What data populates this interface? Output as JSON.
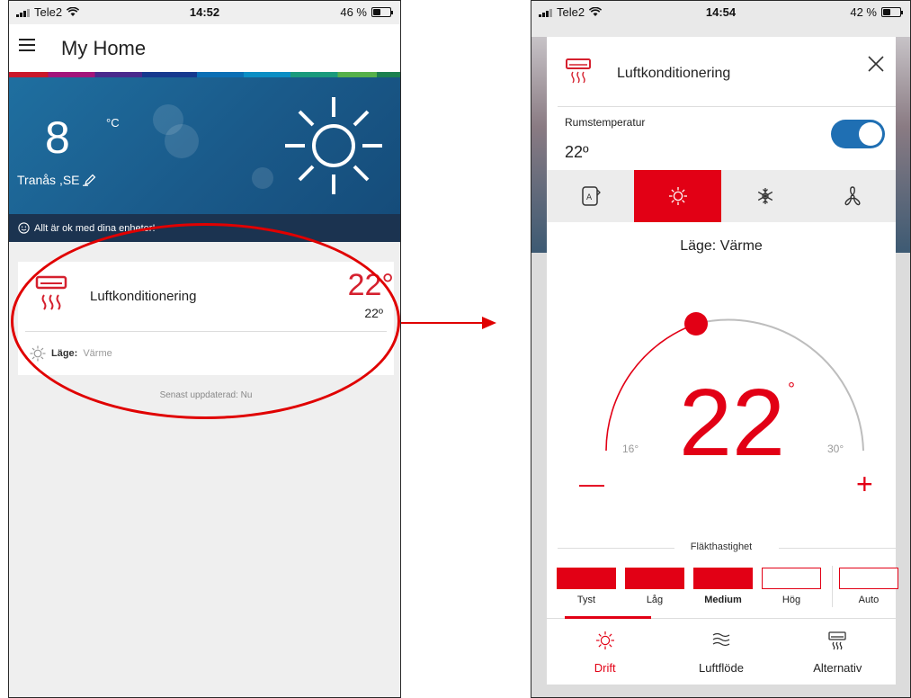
{
  "left_screen": {
    "status": {
      "carrier": "Tele2",
      "time": "14:52",
      "battery": "46 %",
      "battery_level": 0.46
    },
    "header": {
      "title": "My Home"
    },
    "weather": {
      "temperature": "8",
      "unit": "°C",
      "location": "Tranås ,SE"
    },
    "status_message": "Allt är ok med dina enheter!",
    "device": {
      "name": "Luftkonditionering",
      "set_temperature": "22°",
      "room_temperature": "22º",
      "mode_label": "Läge:",
      "mode_value": "Värme"
    },
    "last_updated": "Senast uppdaterad: Nu"
  },
  "right_screen": {
    "status": {
      "carrier": "Tele2",
      "time": "14:54",
      "battery": "42 %",
      "battery_level": 0.42
    },
    "title": "Luftkonditionering",
    "room_temp_label": "Rumstemperatur",
    "room_temp_value": "22º",
    "power_on": true,
    "modes": [
      "auto-mode",
      "heat-mode",
      "cool-mode",
      "fan-mode"
    ],
    "active_mode": "heat-mode",
    "mode_text": {
      "prefix": "Läge:",
      "value": "Värme"
    },
    "dial": {
      "min_label": "16°",
      "max_label": "30°",
      "value": "22",
      "degree": "°",
      "minus": "—",
      "plus": "+"
    },
    "fan": {
      "title": "Fläkthastighet",
      "levels": [
        {
          "label": "Tyst",
          "on": true
        },
        {
          "label": "Låg",
          "on": true
        },
        {
          "label": "Medium",
          "on": true,
          "selected": true
        },
        {
          "label": "Hög",
          "on": false
        },
        {
          "label": "Auto",
          "on": false
        }
      ]
    },
    "tabs": [
      {
        "label": "Drift",
        "icon": "sun-icon",
        "active": true
      },
      {
        "label": "Luftflöde",
        "icon": "airflow-icon",
        "active": false
      },
      {
        "label": "Alternativ",
        "icon": "ac-unit-icon",
        "active": false
      }
    ]
  },
  "colors": {
    "accent": "#e20015",
    "toggle": "#1f6fb3",
    "weather_bg": "#1a5a8a",
    "status_bar_bg": "#1b3350",
    "annotation": "#e00000"
  }
}
